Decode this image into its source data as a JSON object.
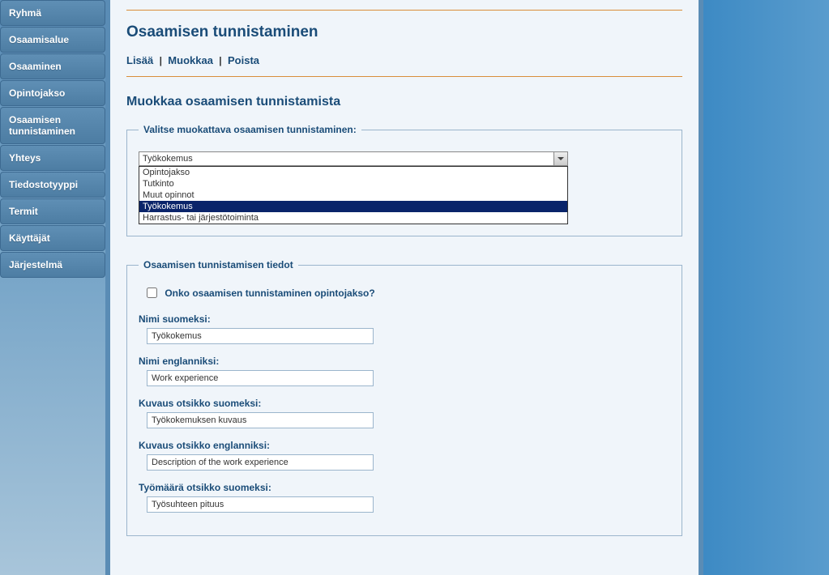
{
  "sidebar": {
    "items": [
      {
        "label": "Ryhmä"
      },
      {
        "label": "Osaamisalue"
      },
      {
        "label": "Osaaminen"
      },
      {
        "label": "Opintojakso"
      },
      {
        "label": "Osaamisen tunnistaminen"
      },
      {
        "label": "Yhteys"
      },
      {
        "label": "Tiedostotyyppi"
      },
      {
        "label": "Termit"
      },
      {
        "label": "Käyttäjät"
      },
      {
        "label": "Järjestelmä"
      }
    ]
  },
  "page": {
    "title": "Osaamisen tunnistaminen",
    "actions": {
      "add": "Lisää",
      "edit": "Muokkaa",
      "delete": "Poista"
    },
    "subtitle": "Muokkaa osaamisen tunnistamista"
  },
  "selectFieldset": {
    "legend": "Valitse muokattava osaamisen tunnistaminen:",
    "selected": "Työkokemus",
    "options": [
      "Opintojakso",
      "Tutkinto",
      "Muut opinnot",
      "Työkokemus",
      "Harrastus- tai järjestötoiminta"
    ]
  },
  "detailsFieldset": {
    "legend": "Osaamisen tunnistamisen tiedot",
    "checkboxLabel": "Onko osaamisen tunnistaminen opintojakso?",
    "fields": {
      "nameFi": {
        "label": "Nimi suomeksi:",
        "value": "Työkokemus"
      },
      "nameEn": {
        "label": "Nimi englanniksi:",
        "value": "Work experience"
      },
      "descTitleFi": {
        "label": "Kuvaus otsikko suomeksi:",
        "value": "Työkokemuksen kuvaus"
      },
      "descTitleEn": {
        "label": "Kuvaus otsikko englanniksi:",
        "value": "Description of the work experience"
      },
      "workloadTitleFi": {
        "label": "Työmäärä otsikko suomeksi:",
        "value": "Työsuhteen pituus"
      }
    }
  }
}
